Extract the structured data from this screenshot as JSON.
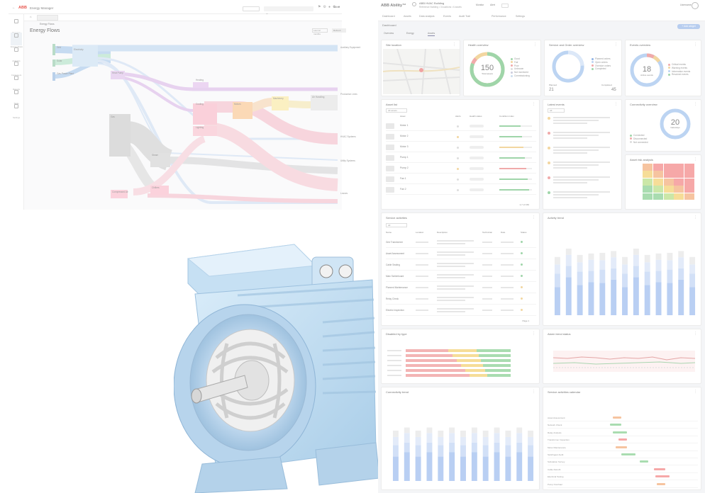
{
  "energy": {
    "brand": "ABB",
    "app_title": "Energy Manager",
    "tab_label": "Energy Flows",
    "page_title": "Energy Flows",
    "user": "Sales",
    "actions": [
      "Last 12 months",
      "Refresh"
    ],
    "sidebar": [
      "Overview",
      "Energy Flows",
      "Analytics",
      "Consumers",
      "Reports",
      "Tasks",
      "Settings"
    ],
    "flows": {
      "sources": [
        "Grid",
        "Solar",
        "Gas Power Plant"
      ],
      "nodes": [
        "Electricity",
        "Gas",
        "Heat Pump",
        "Boiler",
        "Heating",
        "Cooling",
        "Lighting",
        "Motors",
        "Machinery",
        "Air Handling",
        "Steam",
        "Compressed Air",
        "Chillers"
      ],
      "sinks": [
        "Auxiliary Equipment",
        "Production Lines",
        "HVAC Systems",
        "Utility Systems",
        "Losses"
      ]
    },
    "colors": {
      "blue": "#4a90d9",
      "pink": "#f06aa6",
      "purple": "#b067c8",
      "green": "#46b77a",
      "gray": "#8c8c8c",
      "orange": "#f3a245",
      "yellow": "#f2d64b",
      "red": "#ec5a5a"
    }
  },
  "ability": {
    "brand": "ABB Ability™",
    "site": "ABB HVAC Building",
    "site_sub": "Reference Building • 3 locations • 6 assets",
    "header_actions": [
      "Monitor",
      "Alert"
    ],
    "user": "Username",
    "nav": [
      "Dashboard",
      "Assets",
      "Data analysis",
      "Events",
      "Audit Trail",
      "Performance",
      "Settings"
    ],
    "breadcrumb": "Dashboard",
    "add_button": "+ Add widget",
    "tabs": [
      "Overview",
      "Energy",
      "Assets"
    ],
    "cards": {
      "site_location": "Site location",
      "health": {
        "title": "Health overview",
        "value": "150",
        "sub": "Total assets",
        "legend": [
          "Good",
          "Fair",
          "Poor",
          "Unknown",
          "Not monitored",
          "Commissioning"
        ]
      },
      "service": {
        "title": "Service and Order overview",
        "legend": [
          "Planned orders",
          "Open orders",
          "Overdue orders",
          "Completed"
        ],
        "left_label": "Planned",
        "left_value": "21",
        "right_label": "Completed",
        "right_value": "45"
      },
      "events": {
        "title": "Events overview",
        "value": "18",
        "sub": "Active events",
        "legend": [
          "Critical events",
          "Warning events",
          "Information events",
          "Resolved events"
        ]
      },
      "asset_list": {
        "title": "Asset list",
        "filter": "All assets",
        "cols": [
          "Asset",
          "Alerts",
          "Health status",
          "Condition index"
        ],
        "rows": [
          "Motor 1",
          "Motor 2",
          "Motor 3",
          "Pump 1",
          "Pump 2",
          "Fan 1",
          "Fan 2"
        ],
        "pager": "1-7 of 150"
      },
      "latest": {
        "title": "Latest events",
        "filter": "All"
      },
      "connectivity": {
        "title": "Connectivity overview",
        "value": "20",
        "sub": "Gateways",
        "legend": [
          "Connected",
          "Disconnected",
          "Not connected"
        ]
      },
      "risk": {
        "title": "Asset risk analysis"
      },
      "service_activities": {
        "title": "Service activities",
        "filter": "All",
        "cols": [
          "Name",
          "Location",
          "Description",
          "Technician",
          "Date",
          "Status"
        ],
        "rows": [
          "Grid Transformer",
          "Asset Assessment",
          "Cable Sealing",
          "Main Switchboard",
          "Planned Maintenance",
          "Relay Check",
          "Electric Inspection"
        ],
        "pager": "Page 1"
      },
      "activity_trend": {
        "title": "Activity trend"
      },
      "disabled_type": {
        "title": "Disabled by type"
      },
      "alarm_trend": {
        "title": "Alarm trend status"
      },
      "connectivity_trend": {
        "title": "Connectivity trend"
      },
      "service_schedule": {
        "title": "Service activities calendar",
        "rows": [
          "Asset Assessment",
          "Network Check",
          "Relay Analysis",
          "Transformer Inspection",
          "Motor Maintenance",
          "Switchgear Audit",
          "Substation Survey",
          "Cable Retrofit",
          "Electrical Testing",
          "Pump Overhaul"
        ]
      }
    }
  }
}
